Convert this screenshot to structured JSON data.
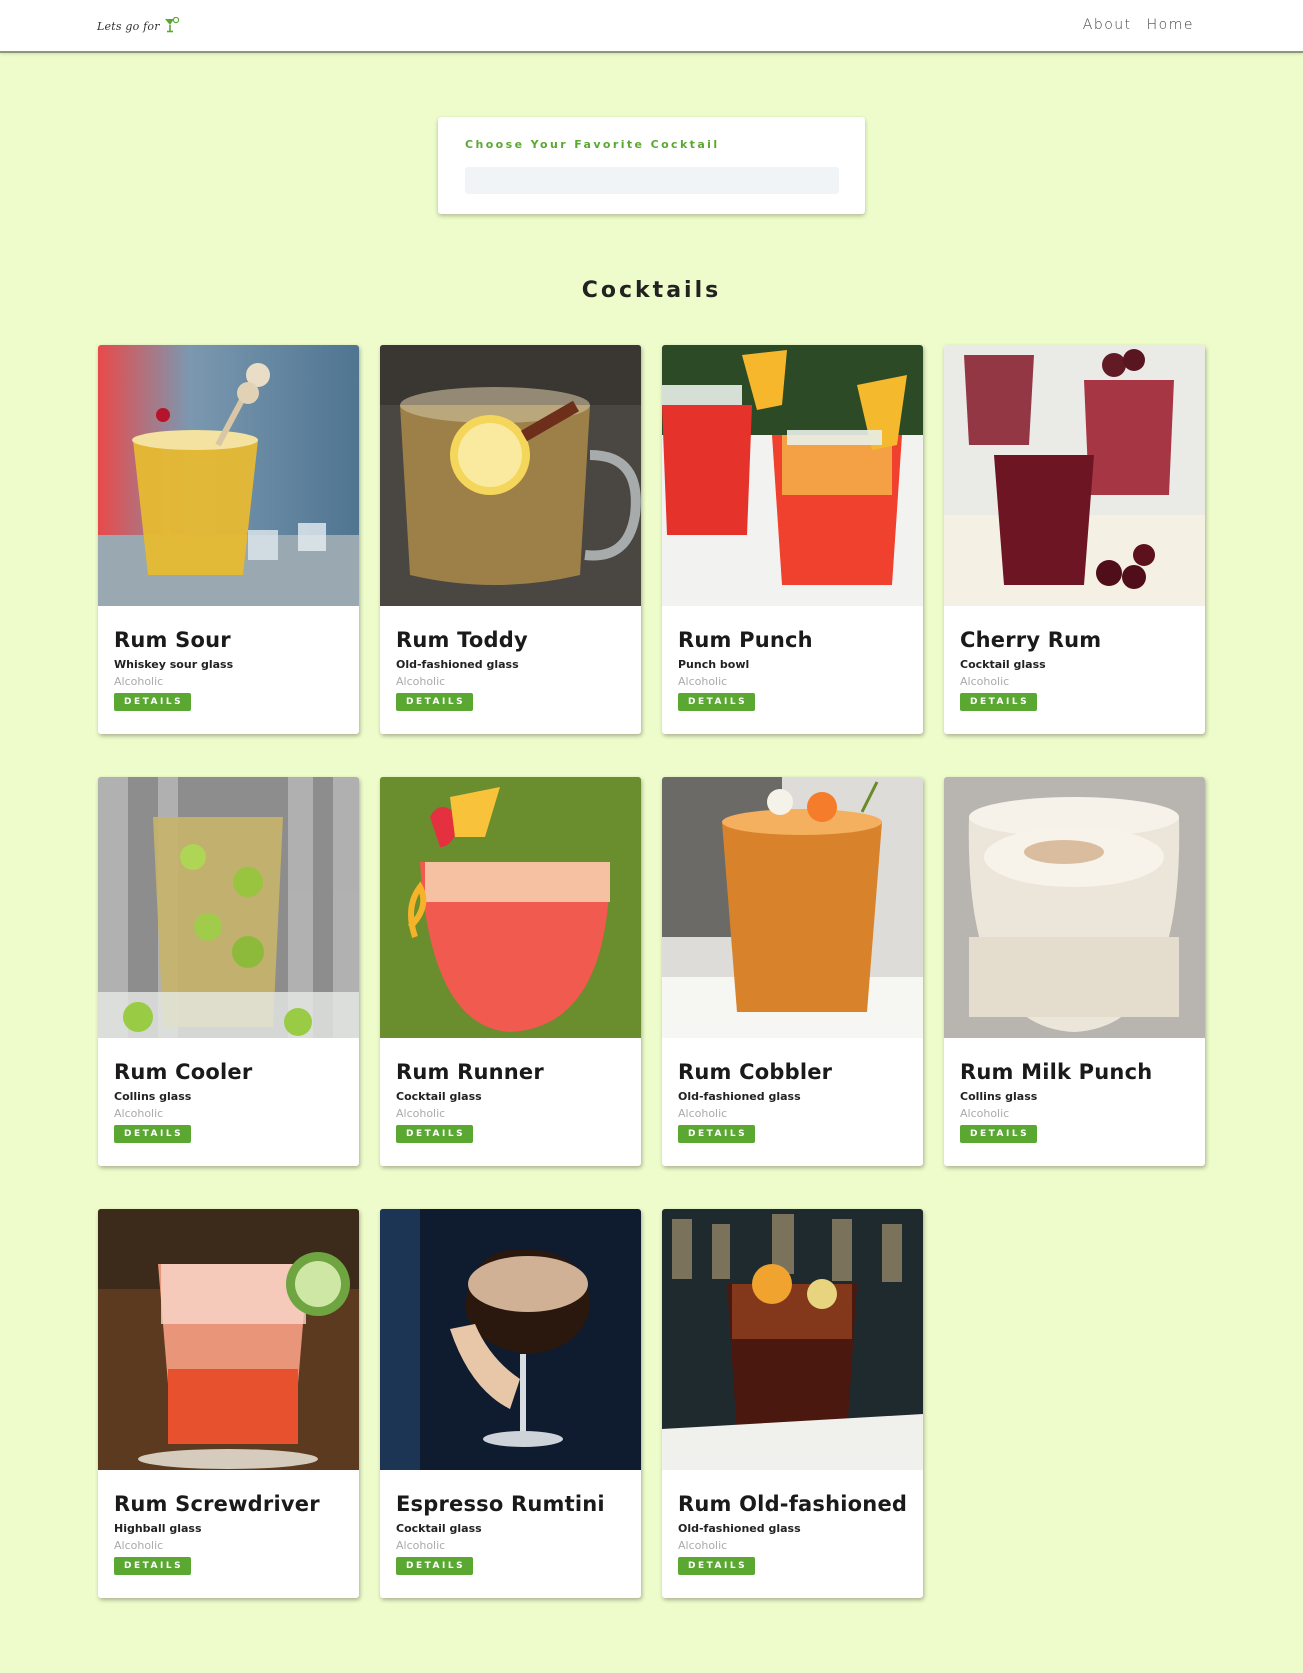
{
  "navbar": {
    "logo_text": "Lets go for",
    "links": [
      "About",
      "Home"
    ]
  },
  "search": {
    "label": "Choose Your Favorite Cocktail",
    "value": "",
    "placeholder": ""
  },
  "section_title": "Cocktails",
  "colors": {
    "background": "#eefccb",
    "accent": "#5aa832"
  },
  "cocktails": [
    {
      "name": "Rum Sour",
      "glass": "Whiskey sour glass",
      "category": "Alcoholic",
      "button": "DETAILS"
    },
    {
      "name": "Rum Toddy",
      "glass": "Old-fashioned glass",
      "category": "Alcoholic",
      "button": "DETAILS"
    },
    {
      "name": "Rum Punch",
      "glass": "Punch bowl",
      "category": "Alcoholic",
      "button": "DETAILS"
    },
    {
      "name": "Cherry Rum",
      "glass": "Cocktail glass",
      "category": "Alcoholic",
      "button": "DETAILS"
    },
    {
      "name": "Rum Cooler",
      "glass": "Collins glass",
      "category": "Alcoholic",
      "button": "DETAILS"
    },
    {
      "name": "Rum Runner",
      "glass": "Cocktail glass",
      "category": "Alcoholic",
      "button": "DETAILS"
    },
    {
      "name": "Rum Cobbler",
      "glass": "Old-fashioned glass",
      "category": "Alcoholic",
      "button": "DETAILS"
    },
    {
      "name": "Rum Milk Punch",
      "glass": "Collins glass",
      "category": "Alcoholic",
      "button": "DETAILS"
    },
    {
      "name": "Rum Screwdriver",
      "glass": "Highball glass",
      "category": "Alcoholic",
      "button": "DETAILS"
    },
    {
      "name": "Espresso Rumtini",
      "glass": "Cocktail glass",
      "category": "Alcoholic",
      "button": "DETAILS"
    },
    {
      "name": "Rum Old-fashioned",
      "glass": "Old-fashioned glass",
      "category": "Alcoholic",
      "button": "DETAILS"
    }
  ]
}
